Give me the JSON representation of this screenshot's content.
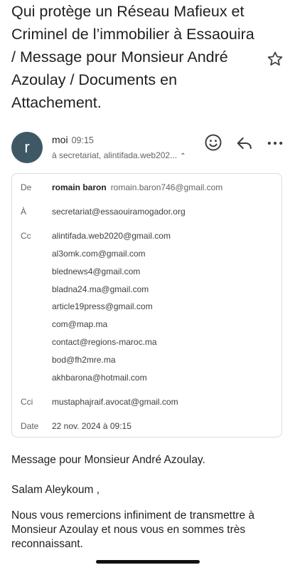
{
  "email": {
    "subject": "Qui protège un Réseau Mafieux et Criminel de l’immobilier à Essaouira / Message pour Monsieur André Azoulay / Documents en Attachement.",
    "sender_short": "moi",
    "time": "09:15",
    "avatar_initial": "r",
    "to_summary": "à secretariat, alintifada.web202...",
    "details": {
      "from_label": "De",
      "from_name": "romain baron",
      "from_email": "romain.baron746@gmail.com",
      "to_label": "À",
      "to_email": "secretariat@essaouiramogador.org",
      "cc_label": "Cc",
      "cc": [
        "alintifada.web2020@gmail.com",
        "al3omk.com@gmail.com",
        "blednews4@gmail.com",
        "bladna24.ma@gmail.com",
        "article19press@gmail.com",
        "com@map.ma",
        "contact@regions-maroc.ma",
        "bod@fh2mre.ma",
        "akhbarona@hotmail.com"
      ],
      "bcc_label": "Cci",
      "bcc_email": "mustaphajraif.avocat@gmail.com",
      "date_label": "Date",
      "date_value": "22 nov. 2024 à 09:15"
    },
    "body": [
      "Message pour Monsieur André Azoulay.",
      "Salam Aleykoum ,",
      "Nous vous remercions infiniment de transmettre à Monsieur Azoulay et nous vous en sommes très reconnaissant."
    ]
  },
  "icons": {
    "star": "star-outline-icon",
    "emoji": "emoji-react-icon",
    "reply": "reply-icon",
    "more": "more-horizontal-icon",
    "chevron": "chevron-up-icon"
  }
}
